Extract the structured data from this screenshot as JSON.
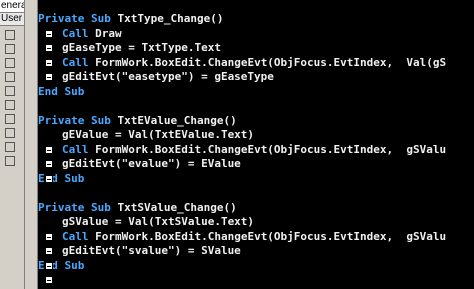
{
  "sidebar": {
    "tabs": [
      "eneral",
      "User"
    ],
    "icon_count": 10
  },
  "code": {
    "lines": [
      {
        "kw": "Private Sub ",
        "tx": "TxtType_Change()",
        "box": false,
        "indent": false
      },
      {
        "kw": "Call ",
        "tx": "Draw",
        "box": true,
        "indent": true
      },
      {
        "kw": "",
        "tx": "gEaseType = TxtType.Text",
        "box": true,
        "indent": true
      },
      {
        "kw": "Call ",
        "tx": "FormWork.BoxEdit.ChangeEvt(ObjFocus.EvtIndex,  Val(gS",
        "box": true,
        "indent": true
      },
      {
        "kw": "",
        "tx": "gEditEvt(\"easetype\") = gEaseType",
        "box": true,
        "indent": true
      },
      {
        "kw": "End Sub",
        "tx": "",
        "box": false,
        "indent": false
      },
      {
        "kw": "",
        "tx": "",
        "box": false,
        "indent": false
      },
      {
        "kw": "Private Sub ",
        "tx": "TxtEValue_Change()",
        "box": false,
        "indent": false
      },
      {
        "kw": "",
        "tx": "gEValue = Val(TxtEValue.Text)",
        "box": false,
        "indent": true
      },
      {
        "kw": "Call ",
        "tx": "FormWork.BoxEdit.ChangeEvt(ObjFocus.EvtIndex,  gSValu",
        "box": true,
        "indent": true
      },
      {
        "kw": "",
        "tx": "gEditEvt(\"evalue\") = EValue",
        "box": true,
        "indent": true
      },
      {
        "kw": "End Sub",
        "tx": "",
        "box": true,
        "indent": false
      },
      {
        "kw": "",
        "tx": "",
        "box": false,
        "indent": false
      },
      {
        "kw": "Private Sub ",
        "tx": "TxtSValue_Change()",
        "box": false,
        "indent": false
      },
      {
        "kw": "",
        "tx": "gSValue = Val(TxtSValue.Text)",
        "box": false,
        "indent": true
      },
      {
        "kw": "Call ",
        "tx": "FormWork.BoxEdit.ChangeEvt(ObjFocus.EvtIndex,  gSValu",
        "box": true,
        "indent": true
      },
      {
        "kw": "",
        "tx": "gEditEvt(\"svalue\") = SValue",
        "box": true,
        "indent": true
      },
      {
        "kw": "End Sub",
        "tx": "",
        "box": true,
        "indent": false
      },
      {
        "kw": "",
        "tx": "",
        "box": true,
        "indent": false
      }
    ]
  },
  "colors": {
    "background": "#000000",
    "keyword": "#4aa8ff",
    "text": "#f0f0f0"
  }
}
